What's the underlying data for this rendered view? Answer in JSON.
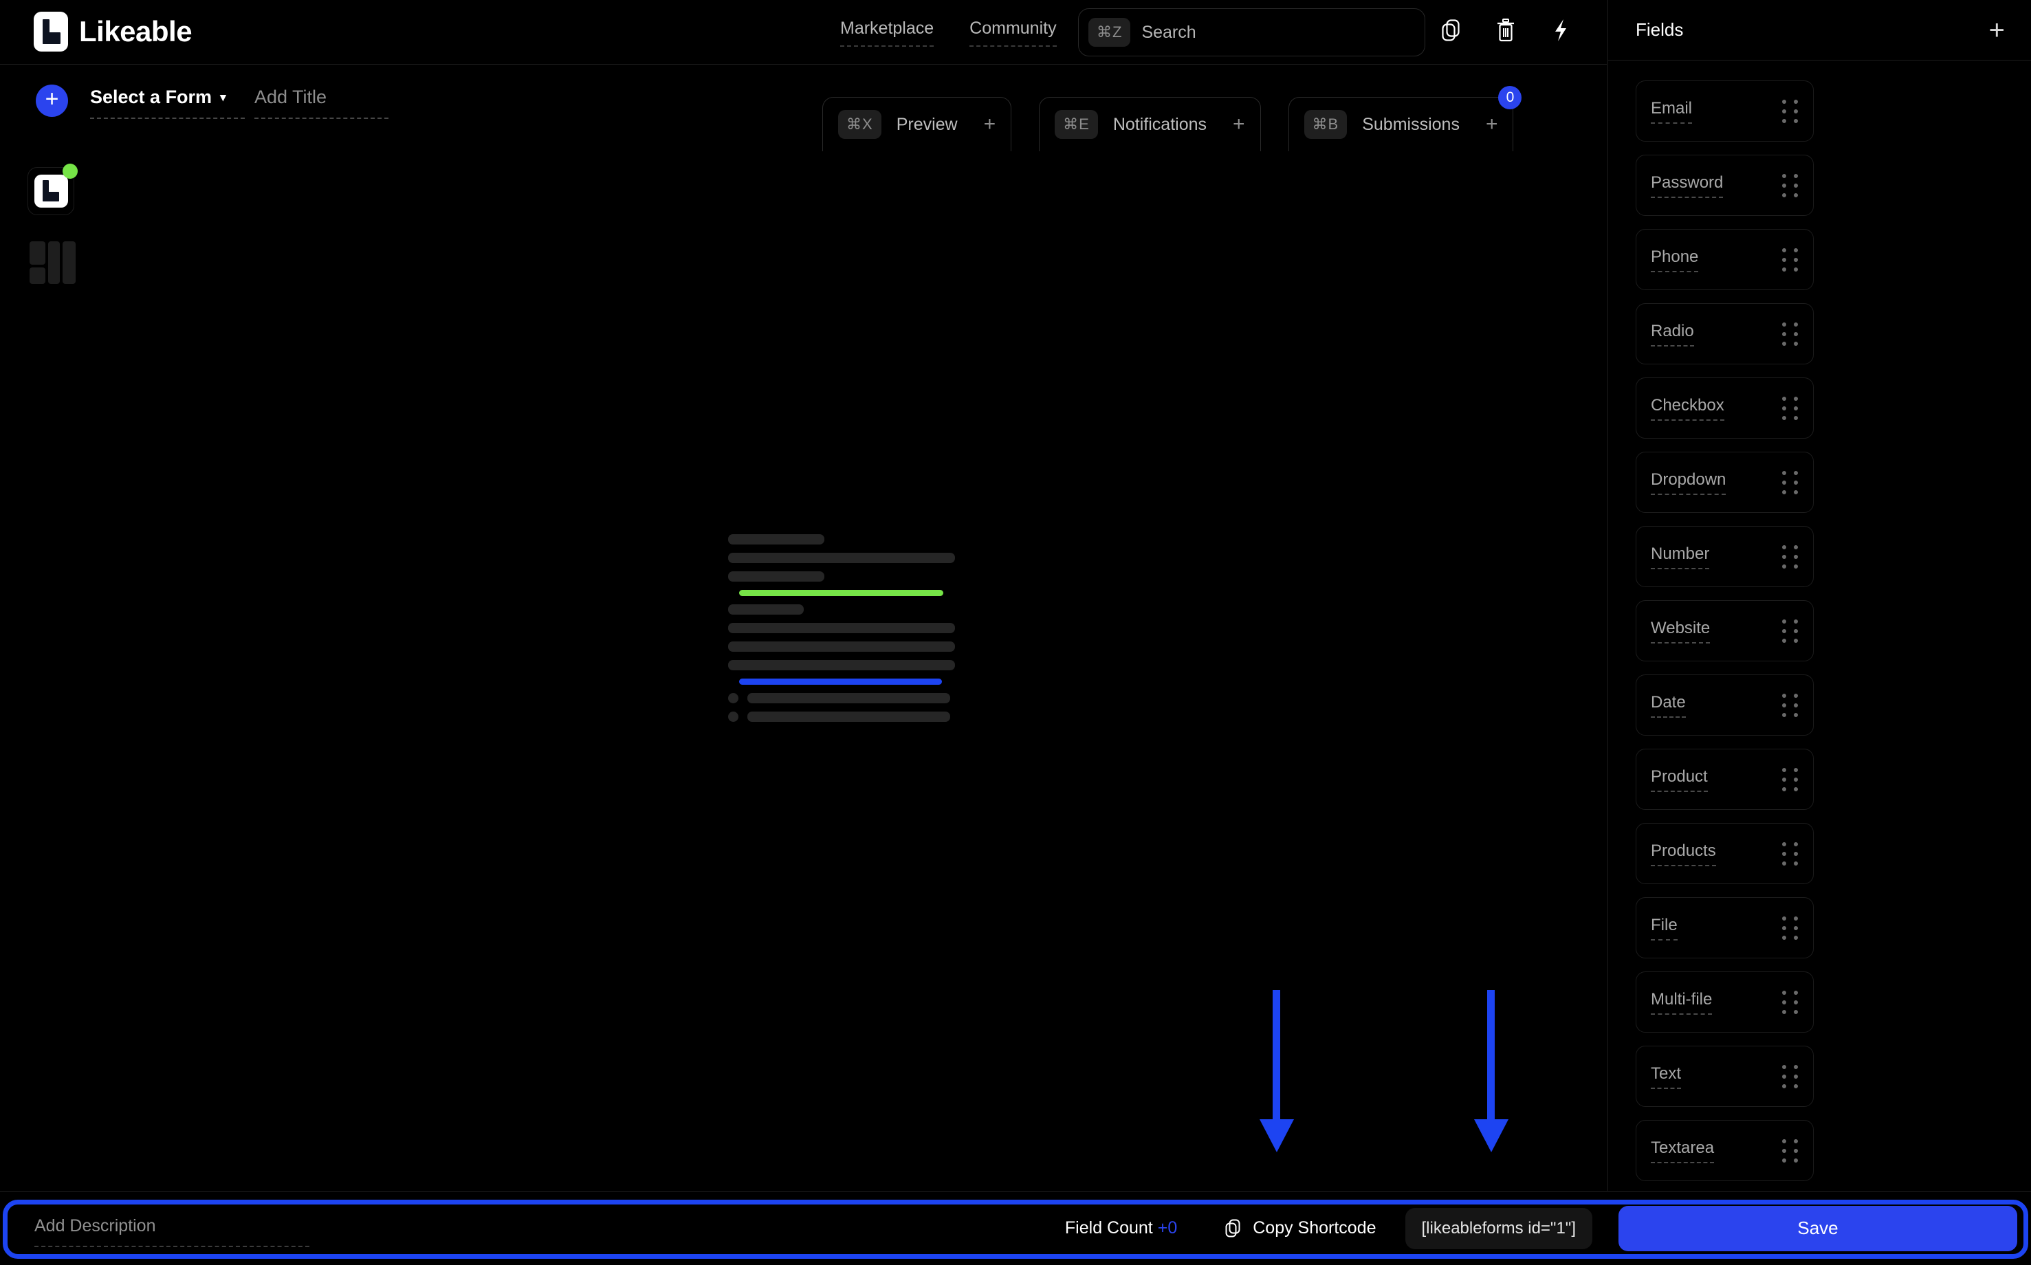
{
  "brand": {
    "name": "Likeable",
    "logo_icon": "likeable-l-logo"
  },
  "topnav": {
    "items": [
      {
        "label": "Marketplace"
      },
      {
        "label": "Community"
      }
    ]
  },
  "search": {
    "shortcut": "⌘Z",
    "placeholder": "Search"
  },
  "top_icons": [
    {
      "name": "duplicate-icon",
      "label": "Duplicate"
    },
    {
      "name": "trash-icon",
      "label": "Delete"
    },
    {
      "name": "lightning-icon",
      "label": "Automations"
    }
  ],
  "form_bar": {
    "add_button": "+",
    "form_select": {
      "label": "Select a Form",
      "caret": "▾"
    },
    "title_input": {
      "placeholder": "Add Title",
      "value": ""
    }
  },
  "tabs": [
    {
      "shortcut": "⌘X",
      "label": "Preview",
      "plus": "+",
      "badge": null
    },
    {
      "shortcut": "⌘E",
      "label": "Notifications",
      "plus": "+",
      "badge": null
    },
    {
      "shortcut": "⌘B",
      "label": "Submissions",
      "plus": "+",
      "badge": "0"
    }
  ],
  "rail": [
    {
      "name": "likeable-logo-tile",
      "status": "online"
    },
    {
      "name": "layout-grid-tile"
    }
  ],
  "panel": {
    "title": "Fields",
    "add_label": "+",
    "fields": [
      {
        "label": "Email"
      },
      {
        "label": "Password"
      },
      {
        "label": "Phone"
      },
      {
        "label": "Radio"
      },
      {
        "label": "Checkbox"
      },
      {
        "label": "Dropdown"
      },
      {
        "label": "Number"
      },
      {
        "label": "Website"
      },
      {
        "label": "Date"
      },
      {
        "label": "Product"
      },
      {
        "label": "Products"
      },
      {
        "label": "File"
      },
      {
        "label": "Multi-file"
      },
      {
        "label": "Text"
      },
      {
        "label": "Textarea"
      }
    ]
  },
  "bottom": {
    "description": {
      "placeholder": "Add Description",
      "value": ""
    },
    "field_count_label": "Field Count",
    "field_count_value": "+0",
    "copy_shortcode_label": "Copy Shortcode",
    "shortcode": "[likeableforms id=\"1\"]",
    "save_label": "Save"
  },
  "colors": {
    "accent_blue": "#2b44ee",
    "annotation_blue": "#1d44f2",
    "status_green": "#76e447",
    "background": "#000000",
    "panel_border": "#1e1e1e"
  },
  "annotations": [
    {
      "name": "arrow-to-shortcode",
      "direction": "down"
    },
    {
      "name": "arrow-to-save",
      "direction": "down"
    }
  ]
}
